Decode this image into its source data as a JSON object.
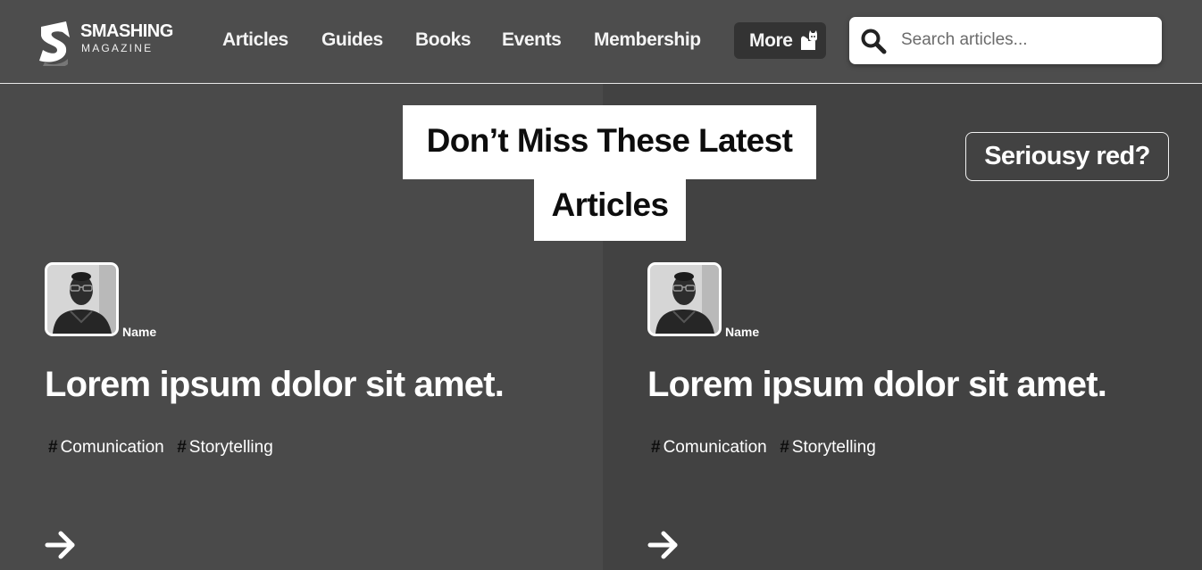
{
  "header": {
    "logo": {
      "brand": "SMASHING",
      "sub": "MAGAZINE",
      "icon": "smashing-s-logo-icon"
    },
    "nav": [
      {
        "label": "Articles"
      },
      {
        "label": "Guides"
      },
      {
        "label": "Books"
      },
      {
        "label": "Events"
      },
      {
        "label": "Membership"
      }
    ],
    "more": {
      "label": "More",
      "icon": "cat-icon"
    },
    "search": {
      "placeholder": "Search articles...",
      "value": "",
      "icon": "search-icon"
    }
  },
  "hero": {
    "title_line1": "Don’t Miss These Latest",
    "title_line2": "Articles",
    "action_label": "Seriousy red?"
  },
  "articles": [
    {
      "author": "Name",
      "title": "Lorem ipsum dolor sit amet.",
      "tags": [
        "Comunication",
        "Storytelling"
      ],
      "arrow_icon": "arrow-right-icon"
    },
    {
      "author": "Name",
      "title": "Lorem ipsum dolor sit amet.",
      "tags": [
        "Comunication",
        "Storytelling"
      ],
      "arrow_icon": "arrow-right-icon"
    }
  ],
  "colors": {
    "header_bg": "#4d4d4d",
    "panel_left_bg": "#4a4a4a",
    "panel_right_bg": "#424242",
    "hero_bg": "#ffffff",
    "hero_text": "#0d0d0d",
    "more_bg": "#333333"
  }
}
